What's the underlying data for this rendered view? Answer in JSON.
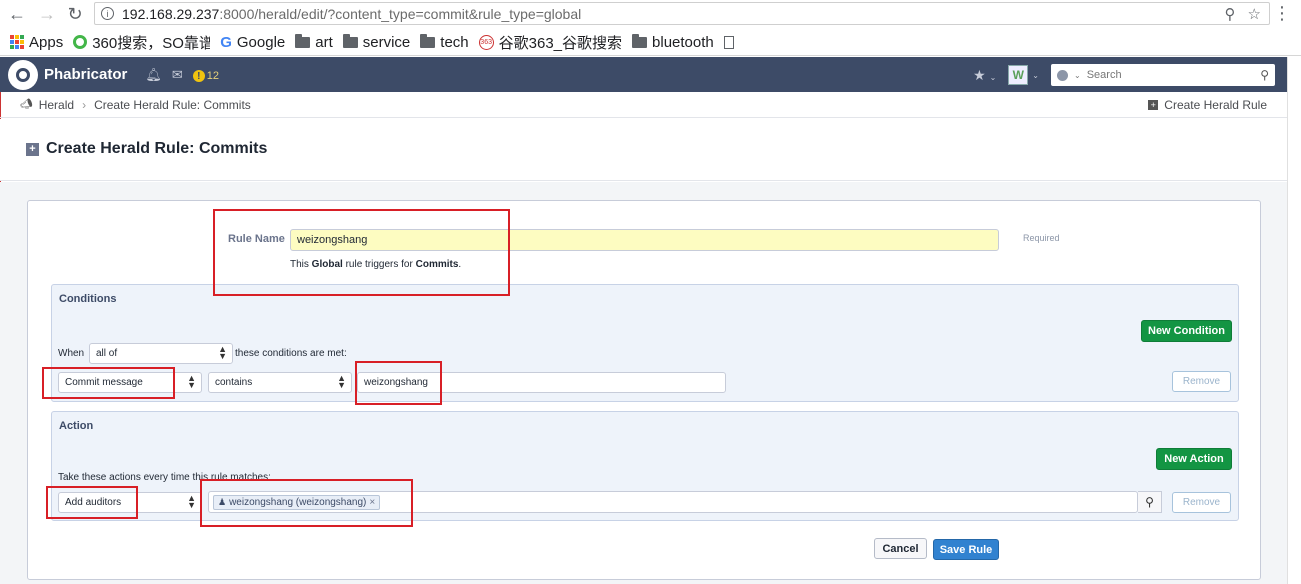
{
  "browser": {
    "url_host": "192.168.29.237",
    "url_rest": ":8000/herald/edit/?content_type=commit&rule_type=global",
    "bookmarks": [
      {
        "label": "Apps",
        "icon": "apps-grid-icon"
      },
      {
        "label": "360搜索，SO靠谱",
        "icon": "360-search-icon"
      },
      {
        "label": "Google",
        "icon": "google-icon"
      },
      {
        "label": "art",
        "icon": "folder-icon"
      },
      {
        "label": "service",
        "icon": "folder-icon"
      },
      {
        "label": "tech",
        "icon": "folder-icon"
      },
      {
        "label": "谷歌363_谷歌搜索",
        "icon": "363-icon"
      },
      {
        "label": "bluetooth",
        "icon": "folder-icon"
      }
    ]
  },
  "app": {
    "name": "Phabricator",
    "notification_count": "12",
    "search_placeholder": "Search",
    "app_badge": "W"
  },
  "crumbs": {
    "root": "Herald",
    "current": "Create Herald Rule: Commits",
    "action": "Create Herald Rule"
  },
  "page": {
    "title": "Create Herald Rule: Commits"
  },
  "form": {
    "rule_name_label": "Rule Name",
    "rule_name_value": "weizongshang",
    "required_hint": "Required",
    "trigger_prefix": "This ",
    "trigger_scope": "Global",
    "trigger_mid": " rule triggers for ",
    "trigger_type": "Commits",
    "trigger_suffix": "."
  },
  "conditions": {
    "heading": "Conditions",
    "new_button": "New Condition",
    "when_label": "When",
    "match_value": "all of",
    "met_label": "these conditions are met:",
    "field_value": "Commit message",
    "operator_value": "contains",
    "value_text": "weizongshang",
    "remove_button": "Remove"
  },
  "actions": {
    "heading": "Action",
    "new_button": "New Action",
    "intro": "Take these actions every time this rule matches:",
    "action_value": "Add auditors",
    "token_text": "weizongshang (weizongshang)",
    "token_remove": "×",
    "remove_button": "Remove"
  },
  "footer": {
    "cancel": "Cancel",
    "save": "Save Rule"
  },
  "colors": {
    "header_bg": "#3d4b67",
    "green": "#139543",
    "blue": "#3182d0",
    "highlight_box": "#d81f26"
  }
}
